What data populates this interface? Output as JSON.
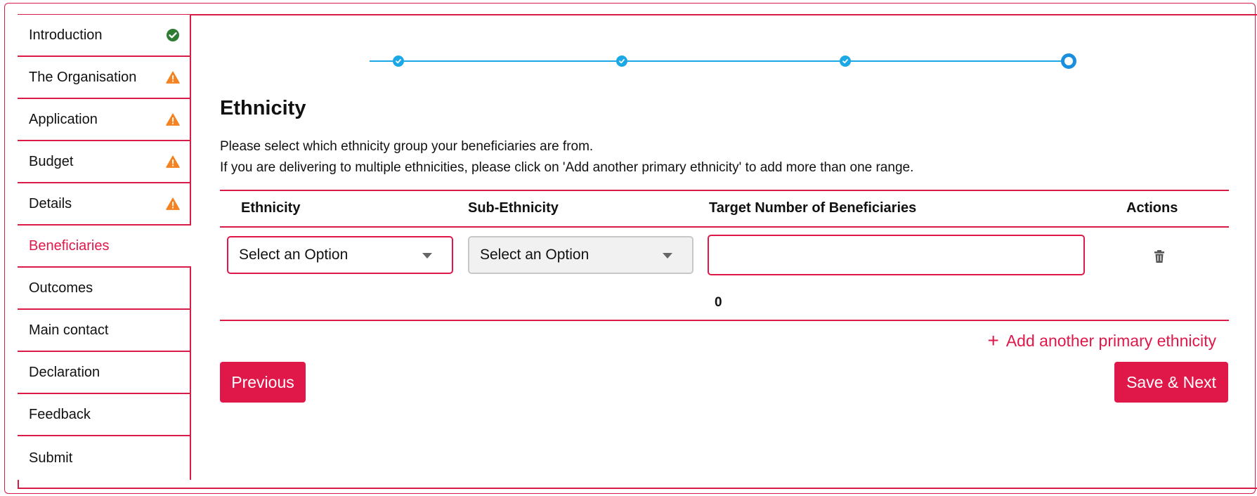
{
  "sidebar": {
    "items": [
      {
        "label": "Introduction",
        "status": "complete"
      },
      {
        "label": "The Organisation",
        "status": "warning"
      },
      {
        "label": "Application",
        "status": "warning"
      },
      {
        "label": "Budget",
        "status": "warning"
      },
      {
        "label": "Details",
        "status": "warning"
      },
      {
        "label": "Beneficiaries",
        "status": "active"
      },
      {
        "label": "Outcomes",
        "status": "none"
      },
      {
        "label": "Main contact",
        "status": "none"
      },
      {
        "label": "Declaration",
        "status": "none"
      },
      {
        "label": "Feedback",
        "status": "none"
      },
      {
        "label": "Submit",
        "status": "none"
      }
    ]
  },
  "stepper": {
    "steps": [
      "complete",
      "complete",
      "complete",
      "current"
    ]
  },
  "section": {
    "title": "Ethnicity",
    "description_line1": "Please select which ethnicity group your beneficiaries are from.",
    "description_line2": "If you are delivering to multiple ethnicities, please click on 'Add another primary ethnicity' to add more than one range."
  },
  "table": {
    "headers": {
      "ethnicity": "Ethnicity",
      "sub_ethnicity": "Sub-Ethnicity",
      "target": "Target Number of Beneficiaries",
      "actions": "Actions"
    },
    "row": {
      "ethnicity_value": "Select an Option",
      "sub_ethnicity_value": "Select an Option",
      "target_value": "",
      "action_icon": "trash-icon"
    },
    "total": "0"
  },
  "actions": {
    "add_label": "Add another primary ethnicity",
    "add_icon": "plus-icon",
    "previous_label": "Previous",
    "save_next_label": "Save & Next"
  },
  "colors": {
    "accent": "#e0184a",
    "stepper": "#1aa8e6",
    "complete": "#2e7d32",
    "warning": "#f58220"
  }
}
